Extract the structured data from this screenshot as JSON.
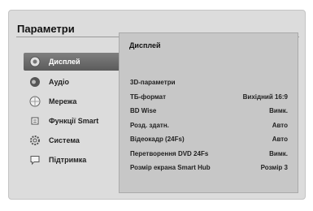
{
  "page": {
    "title": "Параметри"
  },
  "menu": {
    "items": [
      {
        "label": "Дисплей",
        "icon": "display-icon",
        "selected": true
      },
      {
        "label": "Аудіо",
        "icon": "audio-icon",
        "selected": false
      },
      {
        "label": "Мережа",
        "icon": "network-icon",
        "selected": false
      },
      {
        "label": "Функції Smart",
        "icon": "smart-features-icon",
        "selected": false
      },
      {
        "label": "Система",
        "icon": "system-gear-icon",
        "selected": false
      },
      {
        "label": "Підтримка",
        "icon": "support-icon",
        "selected": false
      }
    ]
  },
  "panel": {
    "title": "Дисплей",
    "rows": [
      {
        "label": "3D-параметри",
        "value": ""
      },
      {
        "label": "ТБ-формат",
        "value": "Вихідний 16:9"
      },
      {
        "label": "BD Wise",
        "value": "Вимк."
      },
      {
        "label": "Розд. здатн.",
        "value": "Авто"
      },
      {
        "label": "Відеокадр (24Fs)",
        "value": "Авто"
      },
      {
        "label": "Перетворення DVD 24Fs",
        "value": "Вимк."
      },
      {
        "label": "Розмір екрана Smart Hub",
        "value": "Розмір 3"
      }
    ]
  },
  "colors": {
    "selected_bg": "#6b6b6b",
    "screen_bg": "#dcdcdc",
    "panel_bg": "#c7c7c7"
  }
}
